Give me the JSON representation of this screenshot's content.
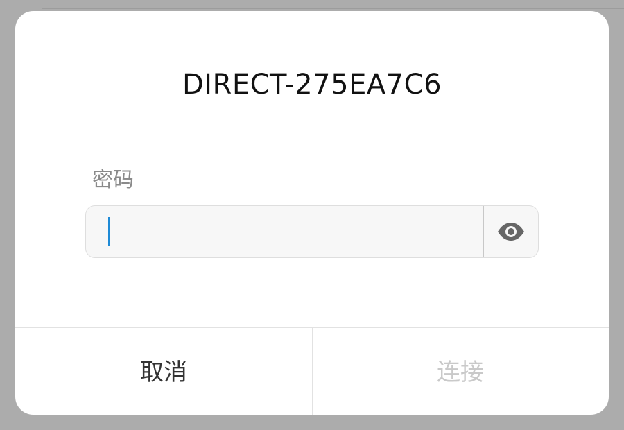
{
  "dialog": {
    "title": "DIRECT-275EA7C6",
    "password_label": "密码",
    "password_value": "",
    "password_placeholder": "",
    "cancel_label": "取消",
    "connect_label": "连接",
    "connect_enabled": false
  },
  "icons": {
    "visibility_toggle": "eye-icon"
  },
  "colors": {
    "caret": "#1e8ad6",
    "cancel_text": "#333333",
    "connect_text_disabled": "#c9c9c9",
    "label_text": "#8a8a8a",
    "scrim": "#acacac"
  }
}
